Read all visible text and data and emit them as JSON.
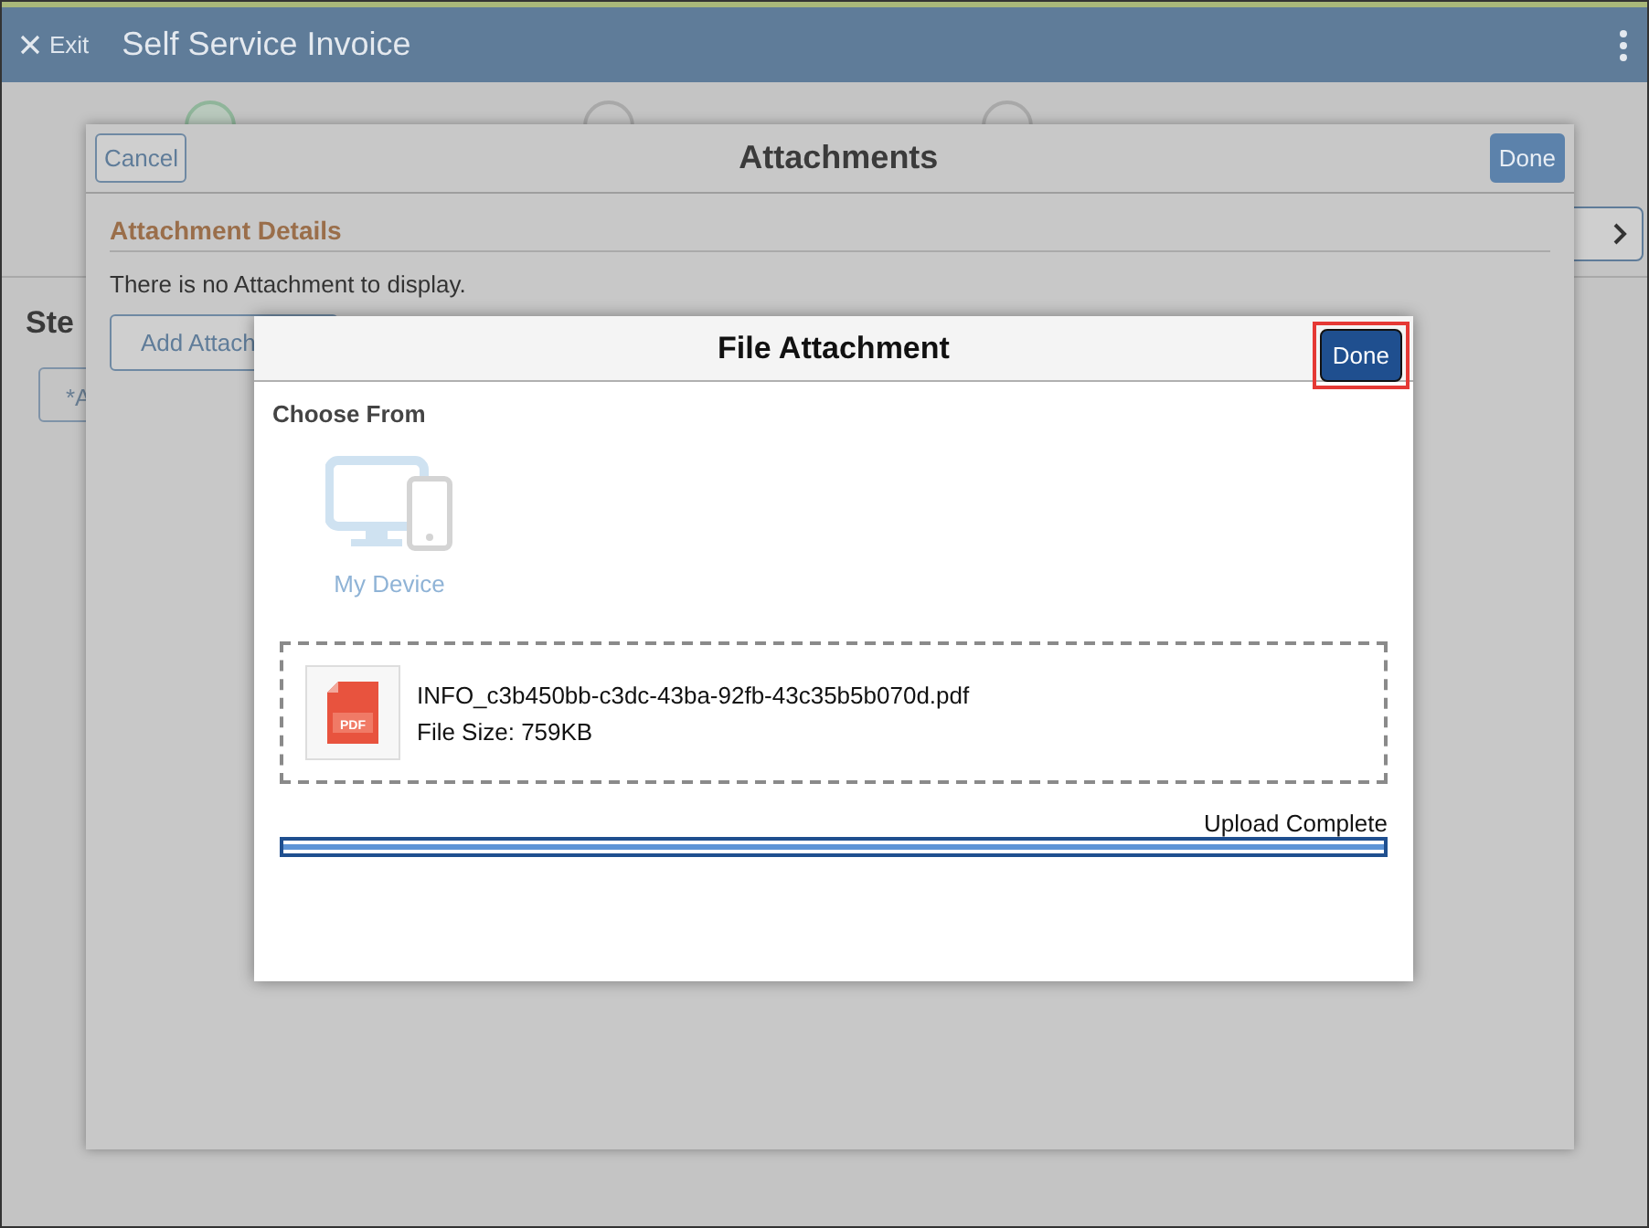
{
  "header": {
    "exit_label": "Exit",
    "title": "Self Service Invoice"
  },
  "steps": [
    {
      "selected": true
    },
    {
      "selected": false
    },
    {
      "selected": false
    }
  ],
  "page": {
    "section_label": "Ste",
    "field_value": "*A"
  },
  "attachments_modal": {
    "cancel": "Cancel",
    "title": "Attachments",
    "done": "Done",
    "section_title": "Attachment Details",
    "empty_message": "There is no Attachment to display.",
    "add_button": "Add Attach"
  },
  "file_dialog": {
    "title": "File Attachment",
    "done": "Done",
    "done_highlighted": true,
    "choose_from": "Choose From",
    "source_label": "My Device",
    "file": {
      "icon_label": "PDF",
      "name": "INFO_c3b450bb-c3dc-43ba-92fb-43c35b5b070d.pdf",
      "size": "File Size: 759KB"
    },
    "status": "Upload Complete",
    "level": 1
  }
}
